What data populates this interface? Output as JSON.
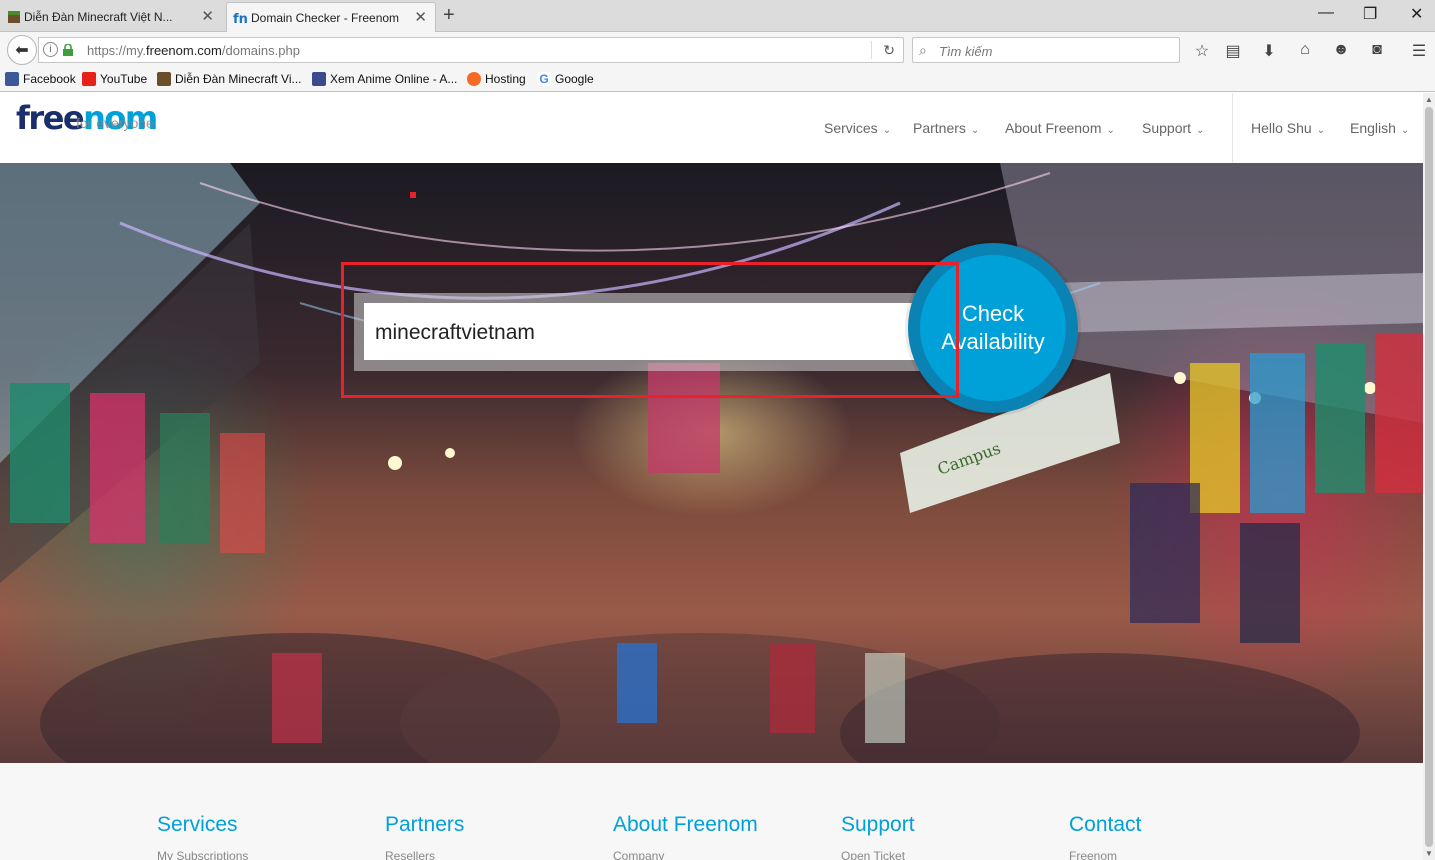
{
  "browser": {
    "tabs": [
      {
        "title": "Diễn Đàn Minecraft Việt N...",
        "active": false
      },
      {
        "title": "Domain Checker - Freenom",
        "active": true
      }
    ],
    "url_prefix": "https://my.",
    "url_domain": "freenom.com",
    "url_path": "/domains.php",
    "search_placeholder": "Tìm kiếm",
    "bookmarks": [
      {
        "label": "Facebook",
        "icon": "facebook-icon",
        "color": "#3b5998"
      },
      {
        "label": "YouTube",
        "icon": "youtube-icon",
        "color": "#e62117"
      },
      {
        "label": "Diễn Đàn Minecraft Vi...",
        "icon": "minecraft-icon",
        "color": "#6b4f2a"
      },
      {
        "label": "Xem Anime Online - A...",
        "icon": "anime-icon",
        "color": "#3a4a8a"
      },
      {
        "label": "Hosting",
        "icon": "hosting-icon",
        "color": "#f46a24"
      },
      {
        "label": "Google",
        "icon": "google-icon",
        "color": "#4285f4"
      }
    ]
  },
  "site": {
    "logo_free": "free",
    "logo_nom": "nom",
    "tagline": "for everyone",
    "nav": {
      "services": "Services",
      "partners": "Partners",
      "about": "About Freenom",
      "support": "Support",
      "user": "Hello Shu",
      "language": "English"
    },
    "search_value": "minecraftvietnam",
    "check_label_1": "Check",
    "check_label_2": "Availability",
    "accent": "#00a1d8",
    "highlight_color": "#e8212b"
  },
  "footer": [
    {
      "heading": "Services",
      "link": "My Subscriptions"
    },
    {
      "heading": "Partners",
      "link": "Resellers"
    },
    {
      "heading": "About Freenom",
      "link": "Company"
    },
    {
      "heading": "Support",
      "link": "Open Ticket"
    },
    {
      "heading": "Contact",
      "link": "Freenom"
    }
  ]
}
